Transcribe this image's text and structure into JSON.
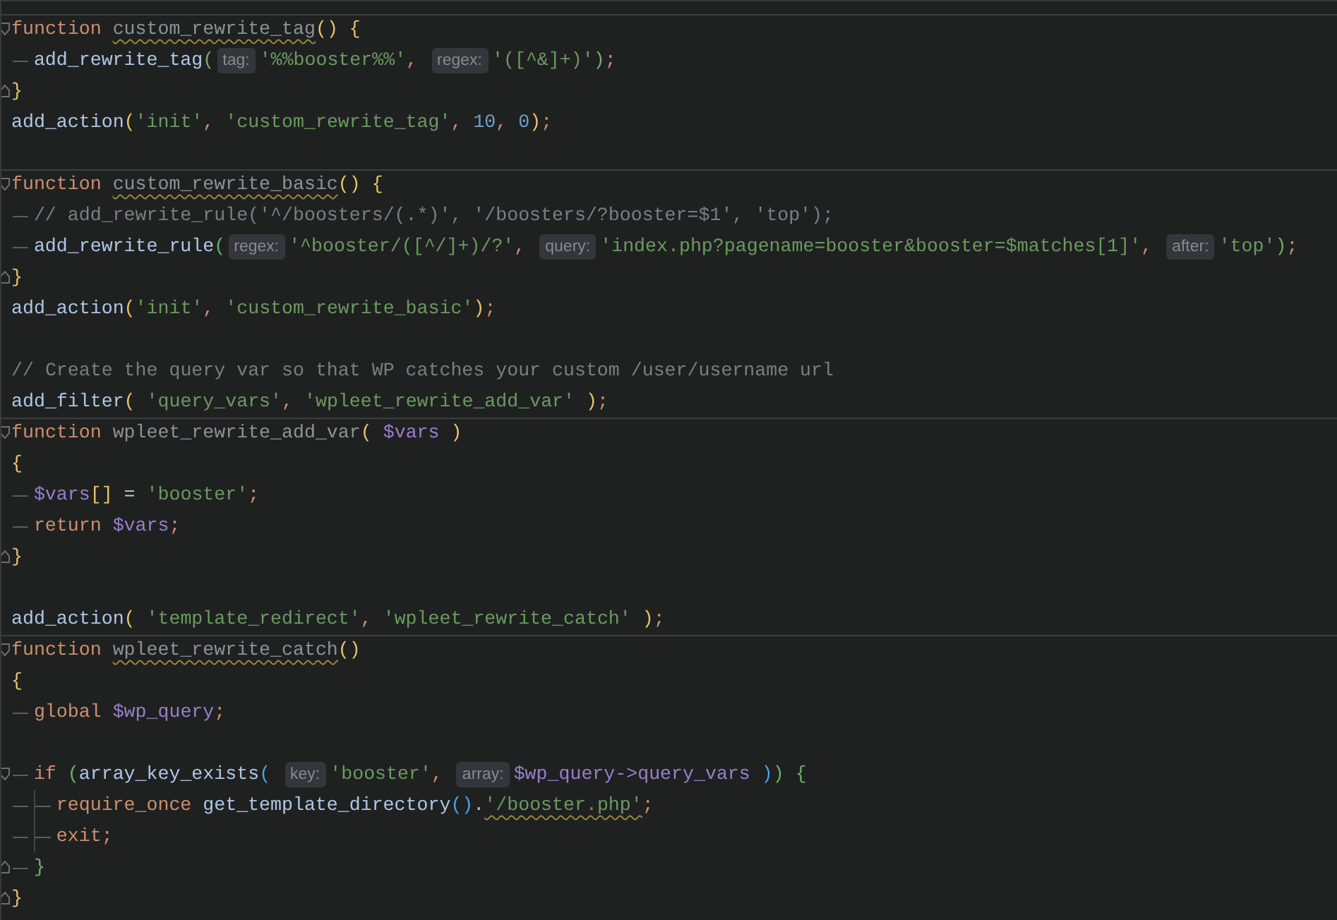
{
  "editor": {
    "lines": [
      {
        "separator": true,
        "kind": "fold-start",
        "tokens": [
          {
            "kind": "kw",
            "text": "function "
          },
          {
            "kind": "decl-warned",
            "text": "custom_rewrite_tag"
          },
          {
            "kind": "y",
            "text": "() {"
          }
        ],
        "children": [
          {
            "separator": false,
            "kind": "plain",
            "tokens": [
              {
                "kind": "call",
                "text": "add_rewrite_tag"
              },
              {
                "kind": "g",
                "text": "("
              },
              {
                "kind": "hint",
                "text": "tag:"
              },
              {
                "kind": "str",
                "text": "'%%booster%%'"
              },
              {
                "kind": "semi",
                "text": ", "
              },
              {
                "kind": "hint",
                "text": "regex:"
              },
              {
                "kind": "str",
                "text": "'([^&]+)'"
              },
              {
                "kind": "g",
                "text": ")"
              },
              {
                "kind": "semi",
                "text": ";"
              }
            ]
          }
        ]
      },
      {
        "separator": false,
        "kind": "fold-end",
        "tokens": [
          {
            "kind": "y",
            "text": "}"
          }
        ]
      },
      {
        "separator": false,
        "kind": "plain",
        "tokens": [
          {
            "kind": "call",
            "text": "add_action"
          },
          {
            "kind": "y",
            "text": "("
          },
          {
            "kind": "str",
            "text": "'init'"
          },
          {
            "kind": "semi",
            "text": ", "
          },
          {
            "kind": "str",
            "text": "'custom_rewrite_tag'"
          },
          {
            "kind": "semi",
            "text": ", "
          },
          {
            "kind": "num",
            "text": "10"
          },
          {
            "kind": "semi",
            "text": ", "
          },
          {
            "kind": "num",
            "text": "0"
          },
          {
            "kind": "y",
            "text": ")"
          },
          {
            "kind": "semi",
            "text": ";"
          }
        ]
      },
      {
        "separator": false,
        "kind": "blank"
      },
      {
        "separator": true,
        "kind": "fold-start",
        "tokens": [
          {
            "kind": "kw",
            "text": "function "
          },
          {
            "kind": "decl-warned",
            "text": "custom_rewrite_basic"
          },
          {
            "kind": "y",
            "text": "() {"
          }
        ],
        "children": [
          {
            "separator": false,
            "kind": "plain",
            "tokens": [
              {
                "kind": "cmt",
                "text": "// add_rewrite_rule('^/boosters/(.*)', '/boosters/?booster=$1', 'top');"
              }
            ]
          },
          {
            "separator": false,
            "kind": "plain",
            "tokens": [
              {
                "kind": "call",
                "text": "add_rewrite_rule"
              },
              {
                "kind": "g",
                "text": "("
              },
              {
                "kind": "hint",
                "text": "regex:"
              },
              {
                "kind": "str",
                "text": "'^booster/([^/]+)/?'"
              },
              {
                "kind": "semi",
                "text": ", "
              },
              {
                "kind": "hint",
                "text": "query:"
              },
              {
                "kind": "str",
                "text": "'index.php?pagename=booster&booster=$matches[1]'"
              },
              {
                "kind": "semi",
                "text": ", "
              },
              {
                "kind": "hint",
                "text": "after:"
              },
              {
                "kind": "str",
                "text": "'top'"
              },
              {
                "kind": "g",
                "text": ")"
              },
              {
                "kind": "semi",
                "text": ";"
              }
            ]
          }
        ]
      },
      {
        "separator": false,
        "kind": "fold-end",
        "tokens": [
          {
            "kind": "y",
            "text": "}"
          }
        ]
      },
      {
        "separator": false,
        "kind": "plain",
        "tokens": [
          {
            "kind": "call",
            "text": "add_action"
          },
          {
            "kind": "y",
            "text": "("
          },
          {
            "kind": "str",
            "text": "'init'"
          },
          {
            "kind": "semi",
            "text": ", "
          },
          {
            "kind": "str",
            "text": "'custom_rewrite_basic'"
          },
          {
            "kind": "y",
            "text": ")"
          },
          {
            "kind": "semi",
            "text": ";"
          }
        ]
      },
      {
        "separator": false,
        "kind": "blank"
      },
      {
        "separator": false,
        "kind": "plain",
        "tokens": [
          {
            "kind": "cmt",
            "text": "// Create the query var so that WP catches your custom /user/username url"
          }
        ]
      },
      {
        "separator": false,
        "kind": "plain",
        "tokens": [
          {
            "kind": "call",
            "text": "add_filter"
          },
          {
            "kind": "y",
            "text": "( "
          },
          {
            "kind": "str",
            "text": "'query_vars'"
          },
          {
            "kind": "semi",
            "text": ", "
          },
          {
            "kind": "str",
            "text": "'wpleet_rewrite_add_var'"
          },
          {
            "kind": "y",
            "text": " )"
          },
          {
            "kind": "semi",
            "text": ";"
          }
        ]
      },
      {
        "separator": true,
        "kind": "fold-start",
        "tokens": [
          {
            "kind": "kw",
            "text": "function "
          },
          {
            "kind": "decl",
            "text": "wpleet_rewrite_add_var"
          },
          {
            "kind": "y",
            "text": "( "
          },
          {
            "kind": "var",
            "text": "$vars"
          },
          {
            "kind": "y",
            "text": " )"
          }
        ]
      },
      {
        "separator": false,
        "kind": "plain",
        "tokens": [
          {
            "kind": "y",
            "text": "{"
          }
        ],
        "children": [
          {
            "separator": false,
            "kind": "plain",
            "tokens": [
              {
                "kind": "var",
                "text": "$vars"
              },
              {
                "kind": "y",
                "text": "[]"
              },
              {
                "kind": "op",
                "text": " = "
              },
              {
                "kind": "str",
                "text": "'booster'"
              },
              {
                "kind": "semi",
                "text": ";"
              }
            ]
          },
          {
            "separator": false,
            "kind": "plain",
            "tokens": [
              {
                "kind": "kw",
                "text": "return "
              },
              {
                "kind": "var",
                "text": "$vars"
              },
              {
                "kind": "semi",
                "text": ";"
              }
            ]
          }
        ]
      },
      {
        "separator": false,
        "kind": "fold-end",
        "tokens": [
          {
            "kind": "y",
            "text": "}"
          }
        ]
      },
      {
        "separator": false,
        "kind": "blank"
      },
      {
        "separator": false,
        "kind": "plain",
        "tokens": [
          {
            "kind": "call",
            "text": "add_action"
          },
          {
            "kind": "y",
            "text": "( "
          },
          {
            "kind": "str",
            "text": "'template_redirect'"
          },
          {
            "kind": "semi",
            "text": ", "
          },
          {
            "kind": "str",
            "text": "'wpleet_rewrite_catch'"
          },
          {
            "kind": "y",
            "text": " )"
          },
          {
            "kind": "semi",
            "text": ";"
          }
        ]
      },
      {
        "separator": true,
        "kind": "fold-start",
        "tokens": [
          {
            "kind": "kw",
            "text": "function "
          },
          {
            "kind": "decl-warned",
            "text": "wpleet_rewrite_catch"
          },
          {
            "kind": "y",
            "text": "()"
          }
        ]
      },
      {
        "separator": false,
        "kind": "plain",
        "tokens": [
          {
            "kind": "y",
            "text": "{"
          }
        ],
        "children": [
          {
            "separator": false,
            "kind": "plain",
            "tokens": [
              {
                "kind": "kw",
                "text": "global "
              },
              {
                "kind": "var",
                "text": "$wp_query"
              },
              {
                "kind": "semi",
                "text": ";"
              }
            ]
          },
          {
            "separator": false,
            "kind": "blank"
          },
          {
            "separator": false,
            "kind": "fold-start",
            "tokens": [
              {
                "kind": "kw",
                "text": "if "
              },
              {
                "kind": "g",
                "text": "("
              },
              {
                "kind": "call",
                "text": "array_key_exists"
              },
              {
                "kind": "b",
                "text": "( "
              },
              {
                "kind": "hint",
                "text": "key:"
              },
              {
                "kind": "str",
                "text": "'booster'"
              },
              {
                "kind": "semi",
                "text": ", "
              },
              {
                "kind": "hint",
                "text": "array:"
              },
              {
                "kind": "var",
                "text": "$wp_query->query_vars"
              },
              {
                "kind": "b",
                "text": " )"
              },
              {
                "kind": "g",
                "text": ") {"
              }
            ],
            "children": [
              {
                "separator": false,
                "kind": "plain",
                "tokens": [
                  {
                    "kind": "kw",
                    "text": "require_once "
                  },
                  {
                    "kind": "call",
                    "text": "get_template_directory"
                  },
                  {
                    "kind": "b",
                    "text": "()"
                  },
                  {
                    "kind": "op",
                    "text": "."
                  },
                  {
                    "kind": "str-warned",
                    "text": "'/booster.php'"
                  },
                  {
                    "kind": "semi",
                    "text": ";"
                  }
                ]
              },
              {
                "separator": false,
                "kind": "plain",
                "tokens": [
                  {
                    "kind": "kw",
                    "text": "exit"
                  },
                  {
                    "kind": "semi",
                    "text": ";"
                  }
                ]
              }
            ]
          },
          {
            "separator": false,
            "kind": "fold-end",
            "tokens": [
              {
                "kind": "g",
                "text": "}"
              }
            ]
          }
        ]
      },
      {
        "separator": false,
        "kind": "fold-end",
        "tokens": [
          {
            "kind": "y",
            "text": "}"
          }
        ]
      }
    ]
  }
}
